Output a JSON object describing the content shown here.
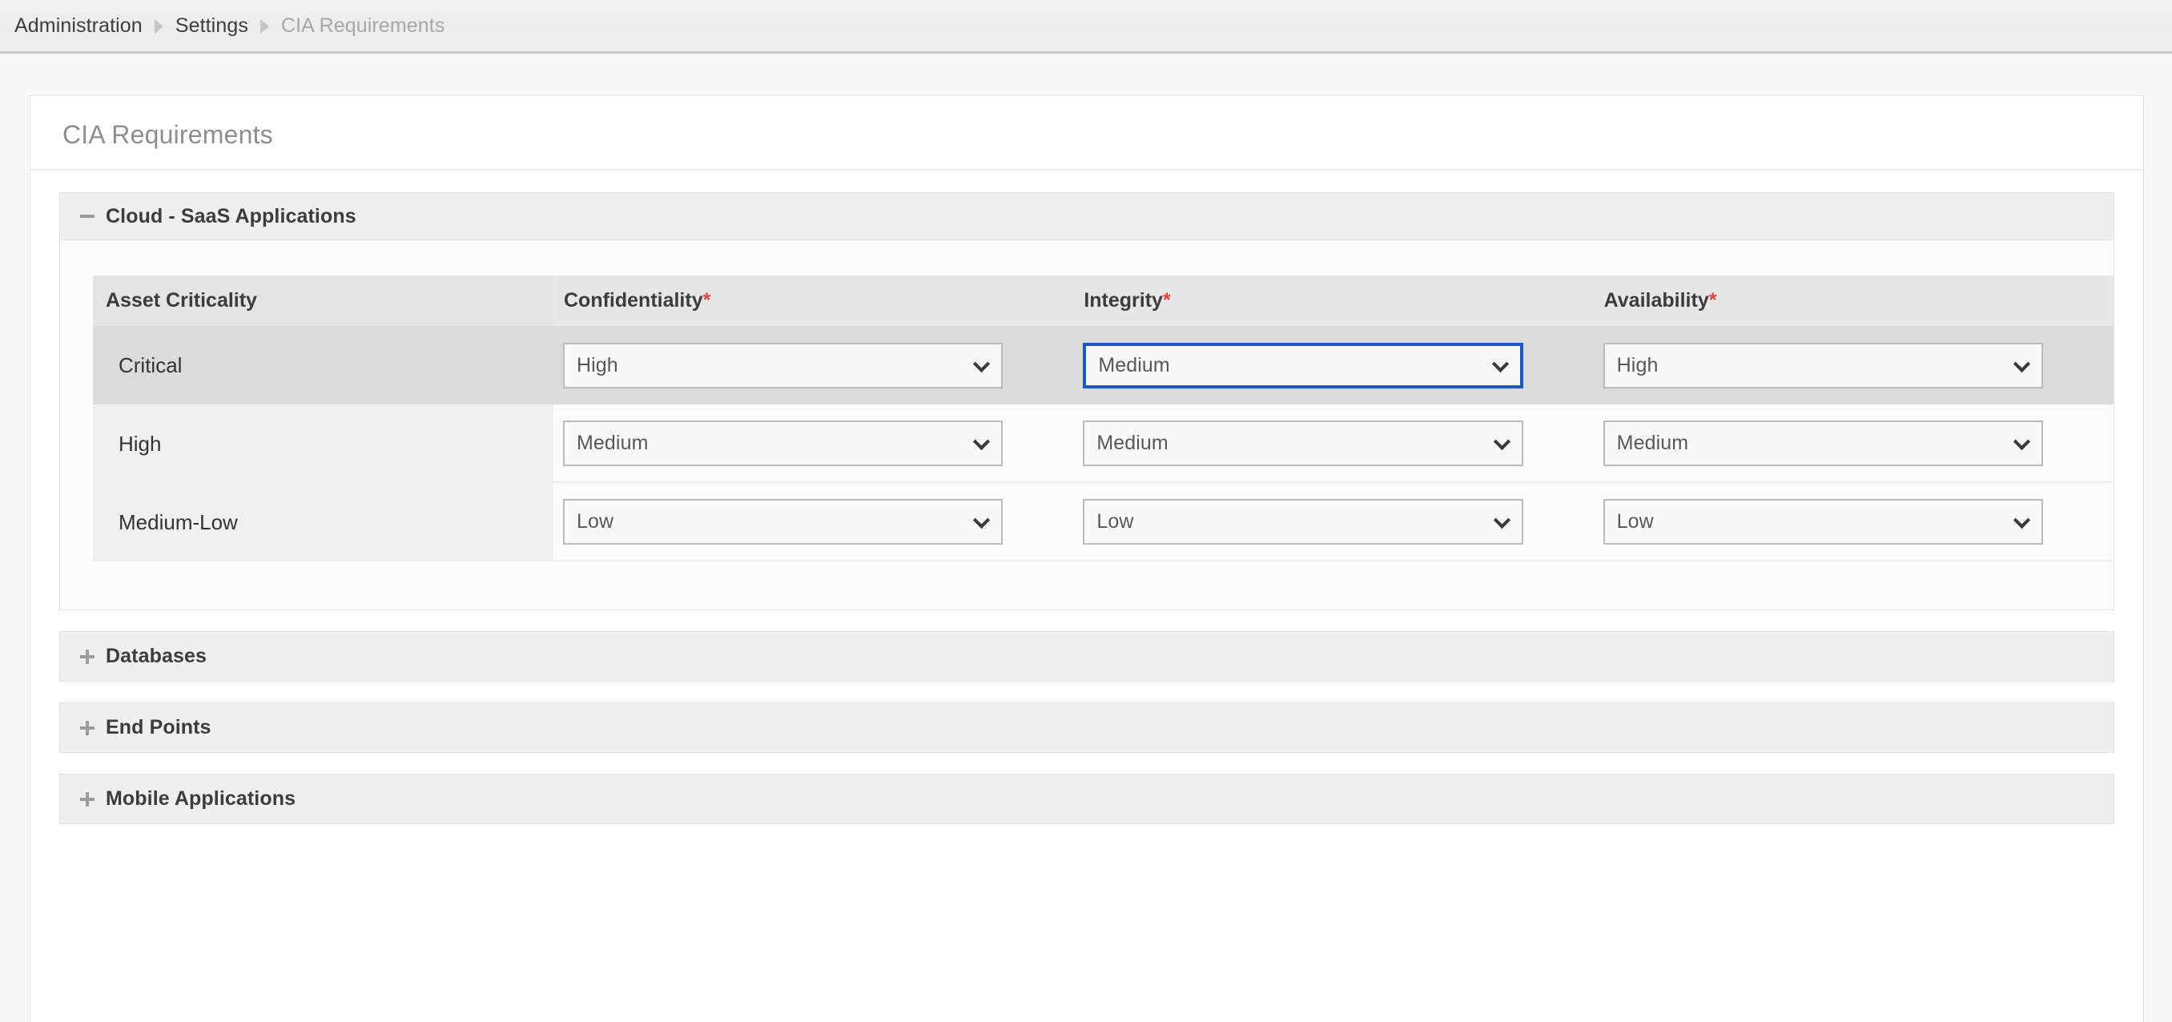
{
  "breadcrumb": {
    "items": [
      {
        "label": "Administration",
        "current": false
      },
      {
        "label": "Settings",
        "current": false
      },
      {
        "label": "CIA Requirements",
        "current": true
      }
    ],
    "separator_icon": "triangle-right-icon"
  },
  "card": {
    "title": "CIA Requirements"
  },
  "sections": [
    {
      "label": "Cloud - SaaS Applications",
      "expanded": true,
      "toggle_icon": "minus-icon",
      "table": {
        "criticality_header": "Asset Criticality",
        "columns": [
          {
            "label": "Confidentiality",
            "required_mark": "*"
          },
          {
            "label": "Integrity",
            "required_mark": "*"
          },
          {
            "label": "Availability",
            "required_mark": "*"
          }
        ],
        "rows": [
          {
            "criticality": "Critical",
            "selected": true,
            "values": [
              {
                "value": "High",
                "focused": false
              },
              {
                "value": "Medium",
                "focused": true
              },
              {
                "value": "High",
                "focused": false
              }
            ]
          },
          {
            "criticality": "High",
            "selected": false,
            "values": [
              {
                "value": "Medium",
                "focused": false
              },
              {
                "value": "Medium",
                "focused": false
              },
              {
                "value": "Medium",
                "focused": false
              }
            ]
          },
          {
            "criticality": "Medium-Low",
            "selected": false,
            "values": [
              {
                "value": "Low",
                "focused": false
              },
              {
                "value": "Low",
                "focused": false
              },
              {
                "value": "Low",
                "focused": false
              }
            ]
          }
        ],
        "options": [
          "High",
          "Medium",
          "Low"
        ]
      }
    },
    {
      "label": "Databases",
      "expanded": false,
      "toggle_icon": "plus-icon"
    },
    {
      "label": "End Points",
      "expanded": false,
      "toggle_icon": "plus-icon"
    },
    {
      "label": "Mobile Applications",
      "expanded": false,
      "toggle_icon": "plus-icon"
    }
  ],
  "colors": {
    "accent_focus": "#1a56c4",
    "required": "#e8413a",
    "page_bg": "#f7f7f8",
    "selected_row": "#dcdcdc"
  }
}
